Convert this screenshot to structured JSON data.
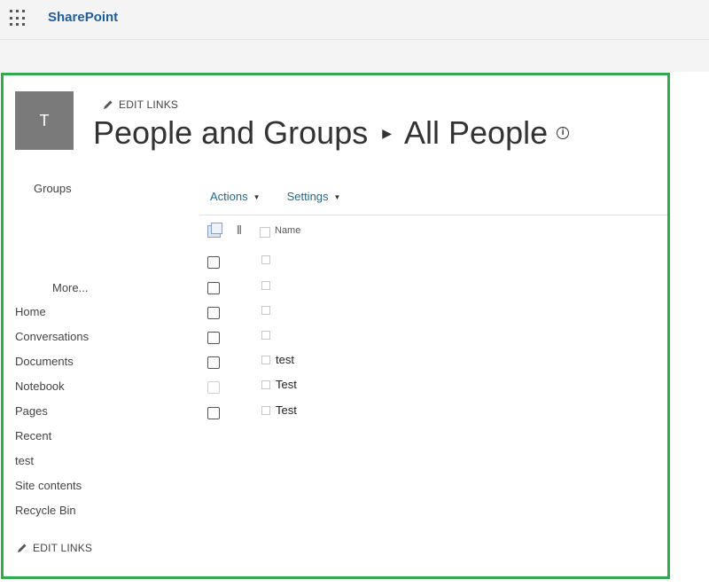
{
  "suite": {
    "brand": "SharePoint"
  },
  "header": {
    "logo_letter": "T",
    "edit_links": "EDIT LINKS",
    "title": "People and Groups",
    "current": "All People"
  },
  "nav": {
    "groups": "Groups",
    "more": "More...",
    "quicklaunch": [
      "Home",
      "Conversations",
      "Documents",
      "Notebook",
      "Pages",
      "Recent",
      "test",
      "Site contents",
      "Recycle Bin"
    ],
    "edit_links": "EDIT LINKS"
  },
  "commands": {
    "actions": "Actions",
    "settings": "Settings"
  },
  "list": {
    "column_name": "Name",
    "rows": [
      {
        "name": ""
      },
      {
        "name": ""
      },
      {
        "name": ""
      },
      {
        "name": ""
      },
      {
        "name": "test"
      },
      {
        "name": "Test"
      },
      {
        "name": "Test"
      }
    ]
  },
  "colors": {
    "frame": "#2eac4d",
    "brand": "#1e5d9a",
    "link": "#1e6a8c"
  }
}
